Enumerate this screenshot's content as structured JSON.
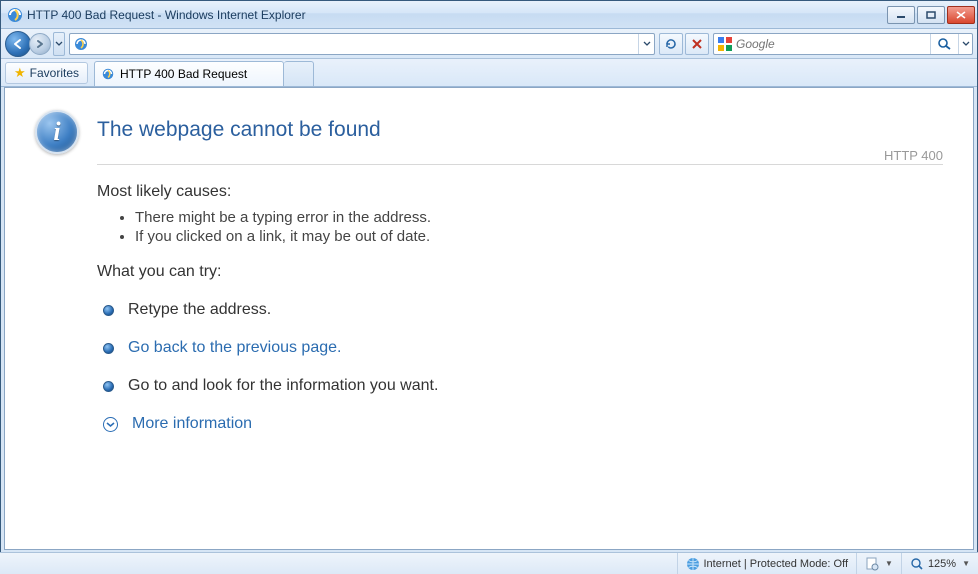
{
  "window": {
    "title": "HTTP 400 Bad Request - Windows Internet Explorer"
  },
  "nav": {
    "address_value": "",
    "search_placeholder": "Google"
  },
  "favbar": {
    "favorites_label": "Favorites"
  },
  "tab": {
    "title": "HTTP 400 Bad Request"
  },
  "error": {
    "heading": "The webpage cannot be found",
    "http_code": "HTTP 400",
    "causes_title": "Most likely causes:",
    "causes": [
      "There might be a typing error in the address.",
      "If you clicked on a link, it may be out of date."
    ],
    "try_title": "What you can try:",
    "try_retype": "Retype the address.",
    "try_goback": "Go back to the previous page.",
    "try_goto": "Go to  and look for the information you want.",
    "more_info": "More information"
  },
  "status": {
    "zone": "Internet | Protected Mode: Off",
    "zoom": "125%"
  }
}
